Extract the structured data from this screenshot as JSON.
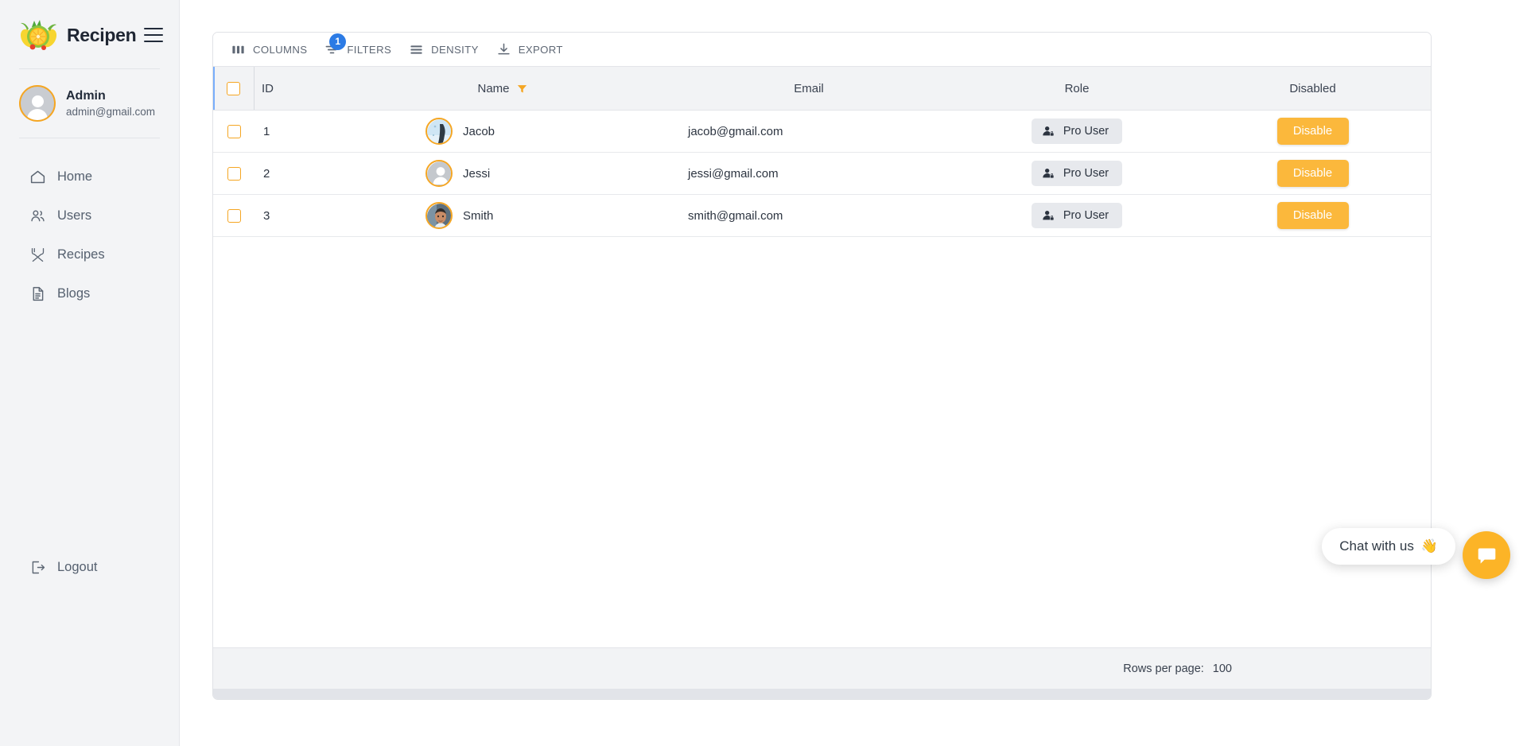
{
  "brand": {
    "title": "Recipen",
    "logo_icon": "citrus-fruit-logo",
    "menu_icon": "hamburger-menu-icon"
  },
  "profile": {
    "name": "Admin",
    "email": "admin@gmail.com",
    "avatar_icon": "person-placeholder-avatar"
  },
  "sidebar": {
    "items": [
      {
        "label": "Home",
        "icon": "home-icon"
      },
      {
        "label": "Users",
        "icon": "users-icon"
      },
      {
        "label": "Recipes",
        "icon": "fork-knife-icon"
      },
      {
        "label": "Blogs",
        "icon": "document-icon"
      }
    ],
    "logout": {
      "label": "Logout",
      "icon": "logout-icon"
    }
  },
  "toolbar": {
    "columns_label": "COLUMNS",
    "filters_label": "FILTERS",
    "filters_badge": "1",
    "density_label": "DENSITY",
    "export_label": "EXPORT",
    "badge_color": "#2c7be5"
  },
  "table": {
    "columns": [
      "ID",
      "Name",
      "Email",
      "Role",
      "Disabled"
    ],
    "name_has_filter_icon": true,
    "select_all_checked": false,
    "rows": [
      {
        "id": "1",
        "name": "Jacob",
        "email": "jacob@gmail.com",
        "role": "Pro User",
        "action": "Disable",
        "avatar_kind": "photo-sky",
        "checked": false
      },
      {
        "id": "2",
        "name": "Jessi",
        "email": "jessi@gmail.com",
        "role": "Pro User",
        "action": "Disable",
        "avatar_kind": "placeholder",
        "checked": false
      },
      {
        "id": "3",
        "name": "Smith",
        "email": "smith@gmail.com",
        "role": "Pro User",
        "action": "Disable",
        "avatar_kind": "photo-man",
        "checked": false
      }
    ]
  },
  "footer": {
    "rows_per_page_label": "Rows per page:",
    "rows_per_page_value": "100"
  },
  "chat": {
    "bubble_text": "Chat with us",
    "bubble_emoji": "👋",
    "fab_icon": "chat-bubble-icon"
  },
  "colors": {
    "accent": "#fbb83c",
    "avatar_ring": "#f5a623",
    "badge_blue": "#2c7be5",
    "sidebar_bg": "#f3f4f6"
  }
}
